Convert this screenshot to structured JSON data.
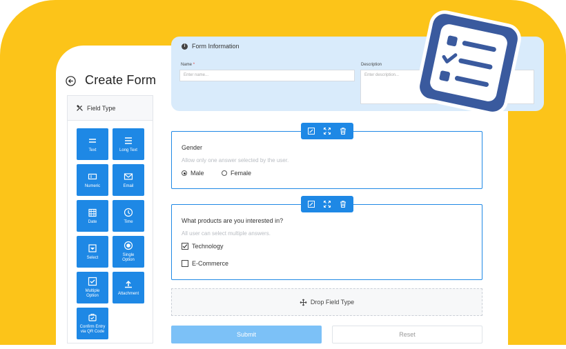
{
  "page": {
    "title": "Create Form"
  },
  "sidebar": {
    "header": "Field Type",
    "items": [
      {
        "label": "Text",
        "icon": "equal-lines-icon"
      },
      {
        "label": "Long Text",
        "icon": "lines-icon"
      },
      {
        "label": "Numeric",
        "icon": "numeric-icon"
      },
      {
        "label": "Email",
        "icon": "envelope-icon"
      },
      {
        "label": "Date",
        "icon": "calendar-icon"
      },
      {
        "label": "Time",
        "icon": "clock-icon"
      },
      {
        "label": "Select",
        "icon": "select-icon"
      },
      {
        "label_lines": [
          "Single",
          "Option"
        ],
        "icon": "radio-icon"
      },
      {
        "label_lines": [
          "Multiple",
          "Option"
        ],
        "icon": "checkbox-icon"
      },
      {
        "label": "Attachment",
        "icon": "upload-icon"
      },
      {
        "label_lines": [
          "Confirm Entry",
          "via QR Code"
        ],
        "icon": "qr-confirm-icon"
      }
    ]
  },
  "form_info": {
    "title": "Form Information",
    "name_label": "Name",
    "name_required": "*",
    "name_placeholder": "Enter name...",
    "description_label": "Description",
    "description_placeholder": "Enter description..."
  },
  "questions": [
    {
      "title": "Gender",
      "hint": "Allow only one answer selected by the user.",
      "options": [
        {
          "label": "Male",
          "selected": true
        },
        {
          "label": "Female",
          "selected": false
        }
      ]
    },
    {
      "title": "What products are you interested in?",
      "hint": "All user can select multiple answers.",
      "options": [
        {
          "label": "Technology",
          "checked": true
        },
        {
          "label": "E-Commerce",
          "checked": false
        }
      ]
    }
  ],
  "dropzone": {
    "label": "Drop Field Type"
  },
  "actions": {
    "submit": "Submit",
    "reset": "Reset"
  },
  "colors": {
    "accent": "#1e88e5",
    "background": "#fcc419",
    "badge": "#3a5a9e",
    "panel": "#d9ebfb"
  }
}
